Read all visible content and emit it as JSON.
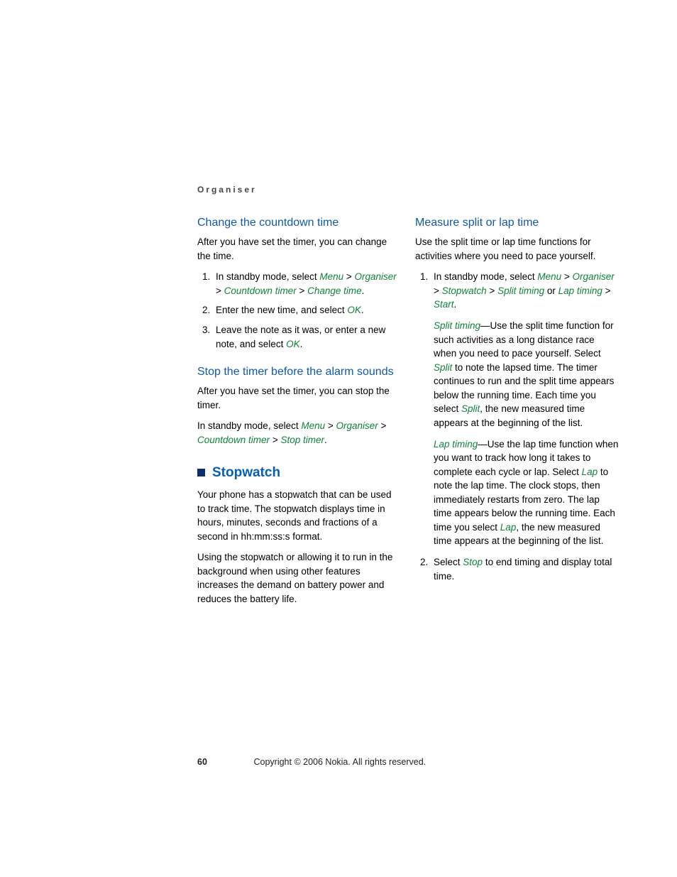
{
  "header": "Organiser",
  "left": {
    "h_countdown": "Change the countdown time",
    "p_after_timer": "After you have set the timer, you can change the time.",
    "step1_a": "In standby mode, select ",
    "menu": "Menu",
    "gt": " > ",
    "organiser": "Organiser",
    "countdown_timer": "Countdown timer",
    "change_time": "Change time",
    "step2_a": "Enter the new time, and select ",
    "ok": "OK",
    "step3_a": "Leave the note as it was, or enter a new note, and select ",
    "h_stop": "Stop the timer before the alarm sounds",
    "p_stop": "After you have set the timer, you can stop the timer.",
    "p_standby_a": "In standby mode, select ",
    "stop_timer": "Stop timer",
    "h_stopwatch": "Stopwatch",
    "p_sw1": "Your phone has a stopwatch that can be used to track time. The stopwatch displays time in hours, minutes, seconds and fractions of a second in hh:mm:ss:s format.",
    "p_sw2": "Using the stopwatch or allowing it to run in the background when using other features increases the demand on battery power and reduces the battery life."
  },
  "right": {
    "h_measure": "Measure split or lap time",
    "p_intro": "Use the split time or lap time functions for activities where you need to pace yourself.",
    "step1_a": "In standby mode, select ",
    "menu": "Menu",
    "gt": " > ",
    "organiser": "Organiser",
    "stopwatch": "Stopwatch",
    "split_timing": "Split timing",
    "or": " or ",
    "lap_timing": "Lap timing",
    "start": "Start",
    "split_desc_a": "—Use the split time function for such activities as a long distance race when you need to pace yourself. Select ",
    "split": "Split",
    "split_desc_b": " to note the lapsed time. The timer continues to run and the split time appears below the running time. Each time you select ",
    "split_desc_c": ", the new measured time appears at the beginning of the list.",
    "lap_desc_a": "—Use the lap time function when you want to track how long it takes to complete each cycle or lap. Select ",
    "lap": "Lap",
    "lap_desc_b": " to note the lap time. The clock stops, then immediately restarts from zero. The lap time appears below the running time. Each time you select ",
    "lap_desc_c": ", the new measured time appears at the beginning of the list.",
    "step2_a": "Select ",
    "stop": "Stop",
    "step2_b": " to end timing and display total time."
  },
  "footer": {
    "page": "60",
    "copyright": "Copyright © 2006 Nokia. All rights reserved."
  }
}
